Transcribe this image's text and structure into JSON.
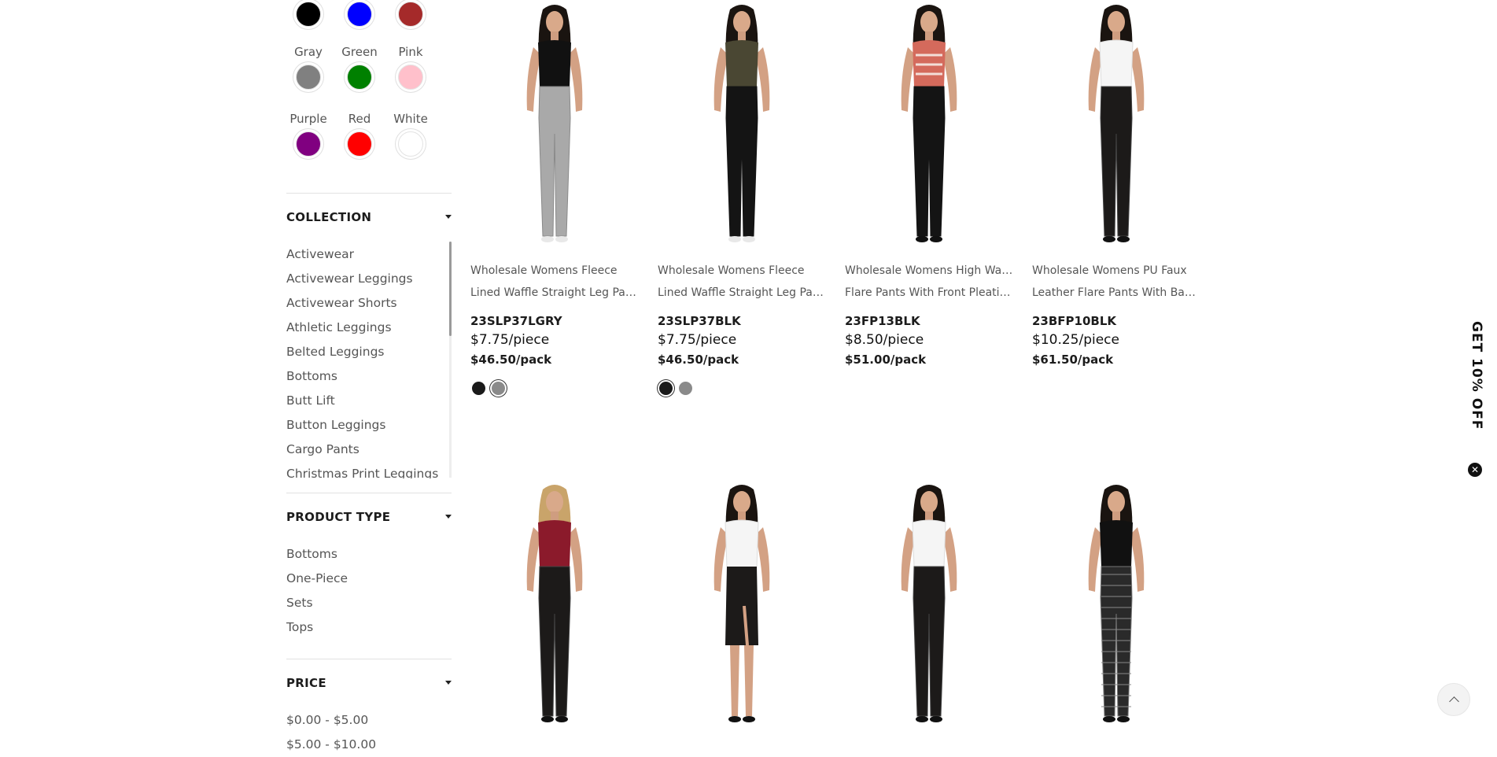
{
  "colors": {
    "row_top": [
      {
        "name": "black",
        "hex": "#000000"
      },
      {
        "name": "blue",
        "hex": "#0000ff"
      },
      {
        "name": "brown",
        "hex": "#a52a2a"
      }
    ],
    "row2": [
      {
        "label": "Gray",
        "hex": "#808080"
      },
      {
        "label": "Green",
        "hex": "#008000"
      },
      {
        "label": "Pink",
        "hex": "#ffc0cb"
      }
    ],
    "row3": [
      {
        "label": "Purple",
        "hex": "#800080"
      },
      {
        "label": "Red",
        "hex": "#ff0000"
      },
      {
        "label": "White",
        "hex": "#ffffff"
      }
    ]
  },
  "collection": {
    "title": "COLLECTION",
    "items": [
      "Activewear",
      "Activewear Leggings",
      "Activewear Shorts",
      "Athletic Leggings",
      "Belted Leggings",
      "Bottoms",
      "Butt Lift",
      "Button Leggings",
      "Cargo Pants",
      "Christmas Print Leggings"
    ]
  },
  "product_type": {
    "title": "PRODUCT TYPE",
    "items": [
      "Bottoms",
      "One-Piece",
      "Sets",
      "Tops"
    ]
  },
  "price": {
    "title": "PRICE",
    "items": [
      "$0.00 - $5.00",
      "$5.00 - $10.00"
    ]
  },
  "products": [
    {
      "line1": "Wholesale Womens Fleece",
      "line2": "Lined Waffle Straight Leg Pant...",
      "sku": "23SLP37LGRY",
      "piece": "$7.75/piece",
      "pack": "$46.50/pack",
      "top": "black",
      "bottom": "gray",
      "swatches": [
        "#1a1a1a",
        "#8a8a8a"
      ],
      "selected": 1
    },
    {
      "line1": "Wholesale Womens Fleece",
      "line2": "Lined Waffle Straight Leg Pant...",
      "sku": "23SLP37BLK",
      "piece": "$7.75/piece",
      "pack": "$46.50/pack",
      "top": "olive",
      "bottom": "black",
      "swatches": [
        "#1a1a1a",
        "#8a8a8a"
      ],
      "selected": 0
    },
    {
      "line1": "Wholesale Womens High Waist",
      "line2": "Flare Pants With Front Pleatin...",
      "sku": "23FP13BLK",
      "piece": "$8.50/piece",
      "pack": "$51.00/pack",
      "top": "houndstooth",
      "bottom": "black"
    },
    {
      "line1": "Wholesale Womens PU Faux",
      "line2": "Leather Flare Pants With Back...",
      "sku": "23BFP10BLK",
      "piece": "$10.25/piece",
      "pack": "$61.50/pack",
      "top": "white",
      "bottom": "leather"
    },
    {
      "top": "burgundy",
      "bottom": "leather"
    },
    {
      "top": "white",
      "bottom": "skirt"
    },
    {
      "top": "white",
      "bottom": "leather"
    },
    {
      "top": "black",
      "bottom": "plaid"
    }
  ],
  "promo": {
    "label": "GET 10% OFF",
    "close": "✕"
  }
}
